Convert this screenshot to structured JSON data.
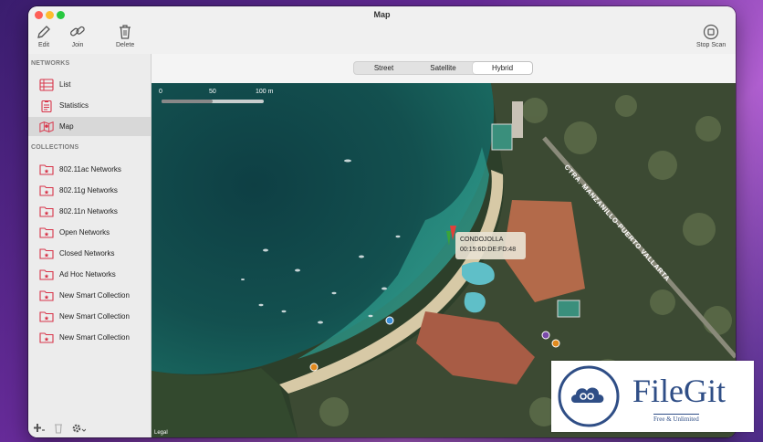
{
  "window": {
    "title": "Map"
  },
  "toolbar": {
    "edit_label": "Edit",
    "join_label": "Join",
    "delete_label": "Delete",
    "stop_scan_label": "Stop Scan"
  },
  "sidebar": {
    "networks_header": "NETWORKS",
    "networks_items": [
      {
        "label": "List",
        "icon": "list-icon"
      },
      {
        "label": "Statistics",
        "icon": "statistics-icon"
      },
      {
        "label": "Map",
        "icon": "map-icon",
        "selected": true
      }
    ],
    "collections_header": "COLLECTIONS",
    "collections_items": [
      {
        "label": "802.11ac Networks",
        "icon": "folder-icon"
      },
      {
        "label": "802.11g Networks",
        "icon": "folder-icon"
      },
      {
        "label": "802.11n Networks",
        "icon": "folder-icon"
      },
      {
        "label": "Open Networks",
        "icon": "folder-icon"
      },
      {
        "label": "Closed Networks",
        "icon": "folder-icon"
      },
      {
        "label": "Ad Hoc Networks",
        "icon": "folder-icon"
      },
      {
        "label": "New Smart Collection",
        "icon": "folder-icon"
      },
      {
        "label": "New Smart Collection",
        "icon": "folder-icon"
      },
      {
        "label": "New Smart Collection",
        "icon": "folder-icon"
      }
    ]
  },
  "map_type": {
    "options": [
      "Street",
      "Satellite",
      "Hybrid"
    ],
    "selected": "Hybrid"
  },
  "map": {
    "scale_ticks": [
      "0",
      "50",
      "100 m"
    ],
    "road_label": "CTRA. MANZANILLO-PUERTO VALLARTA",
    "legal_label": "Legal",
    "pin": {
      "name": "CONDOJOLLA",
      "mac": "00:15:6D:DE:FD:48"
    }
  },
  "watermark": {
    "name": "FileGit",
    "tagline": "Free & Unlimited"
  },
  "colors": {
    "accent_red": "#d8354a",
    "sidebar_bg": "#ececec",
    "watermark_blue": "#2f4e86"
  }
}
